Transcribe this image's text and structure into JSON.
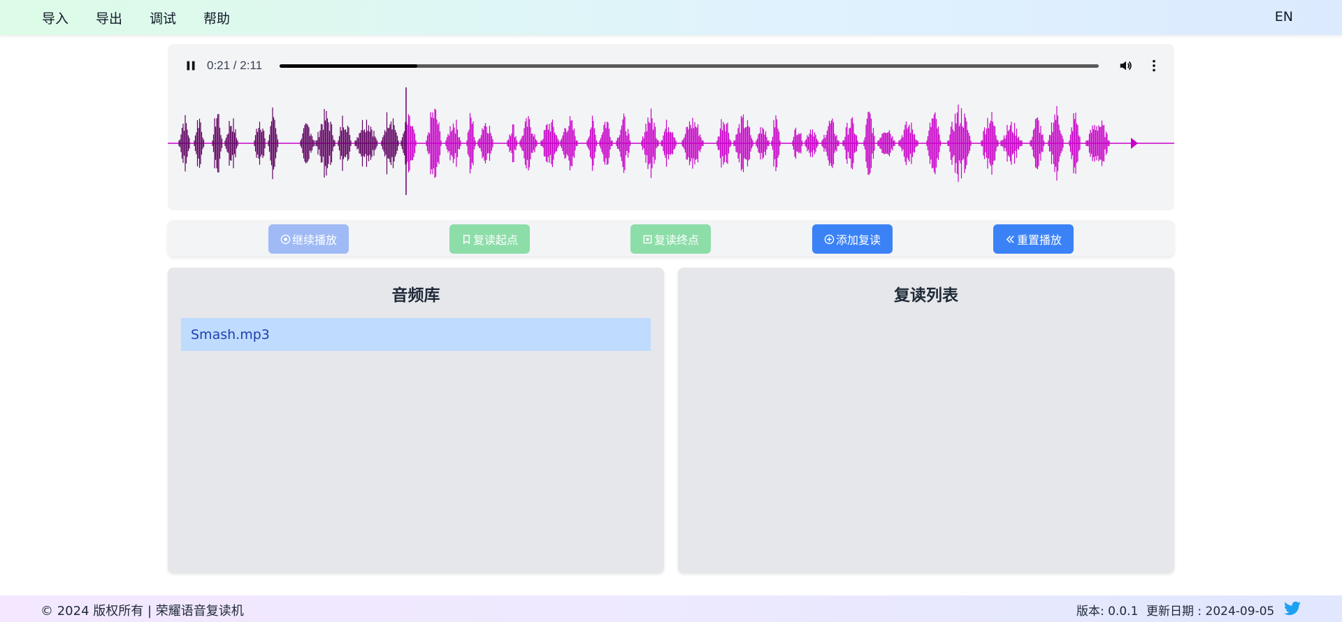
{
  "nav": {
    "menu": [
      "导入",
      "导出",
      "调试",
      "帮助"
    ],
    "lang": "EN"
  },
  "player": {
    "time": "0:21 / 2:11",
    "progress": 0.168,
    "played_color": "#5e0060",
    "wave_color": "#c800c8",
    "icons": [
      "pause-icon",
      "volume-icon",
      "more-vertical-icon"
    ]
  },
  "controls": {
    "continue": "继续播放",
    "start": "复读起点",
    "end": "复读终点",
    "add": "添加复读",
    "reset": "重置播放"
  },
  "library": {
    "title": "音频库",
    "items": [
      "Smash.mp3"
    ]
  },
  "repeat_list": {
    "title": "复读列表"
  },
  "footer": {
    "copyright": "© 2024 版权所有 | 荣耀语音复读机",
    "version": "版本: 0.0.1",
    "updated": "更新日期 : 2024-09-05",
    "icon": "twitter-icon"
  },
  "colors": {
    "primary": "#3b82f6",
    "primary_disabled": "#9fbaf5",
    "success_disabled": "#8ddda9",
    "twitter": "#1da1f2"
  }
}
